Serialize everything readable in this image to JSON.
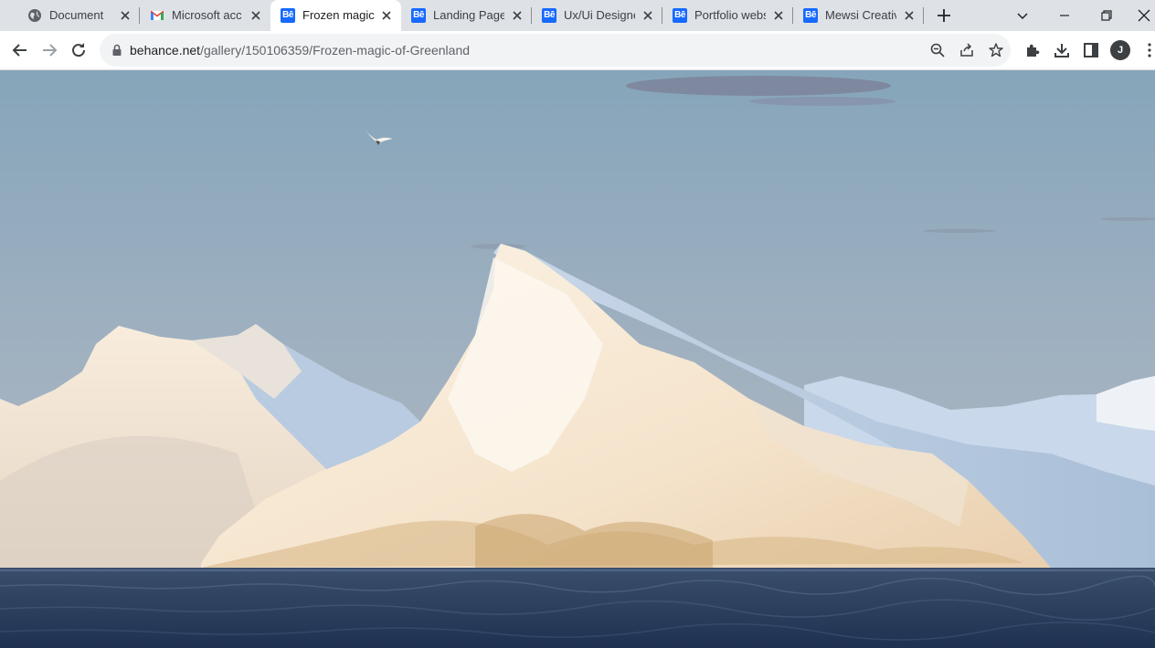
{
  "tabs": [
    {
      "title": "Document",
      "favicon": "globe-icon"
    },
    {
      "title": "Microsoft account",
      "favicon": "gmail-icon"
    },
    {
      "title": "Frozen magic of Greenland",
      "favicon": "behance-icon",
      "active": true
    },
    {
      "title": "Landing Page",
      "favicon": "behance-icon"
    },
    {
      "title": "Ux/Ui Designer",
      "favicon": "behance-icon"
    },
    {
      "title": "Portfolio website",
      "favicon": "behance-icon"
    },
    {
      "title": "Mewsi Creative",
      "favicon": "behance-icon"
    }
  ],
  "favicon_text": "Bē",
  "address_bar": {
    "host": "behance.net",
    "path": "/gallery/150106359/Frozen-magic-of-Greenland"
  },
  "profile_initial": "J",
  "colors": {
    "behance_blue": "#1769ff",
    "tabstrip_bg": "#dee1e6",
    "sky_top": "#86a5ba",
    "sky_bottom": "#b4b9c3",
    "ice_light": "#f6ead8",
    "water": "#2a3d5c"
  }
}
